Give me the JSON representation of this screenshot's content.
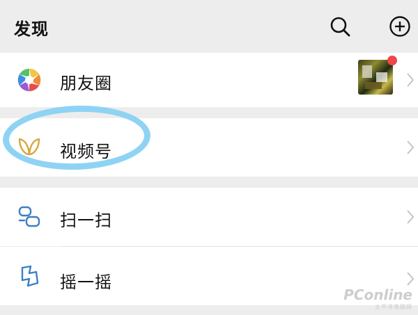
{
  "header": {
    "title": "发现",
    "search_icon": "search-icon",
    "add_icon": "plus-circle-icon"
  },
  "menu": {
    "moments": {
      "label": "朋友圈",
      "icon": "moments-aperture-icon"
    },
    "channels": {
      "label": "视频号",
      "icon": "channels-butterfly-icon"
    },
    "scan": {
      "label": "扫一扫",
      "icon": "scan-icon"
    },
    "shake": {
      "label": "摇一摇",
      "icon": "shake-icon"
    }
  },
  "colors": {
    "background": "#ededed",
    "row": "#ffffff",
    "highlight": "#8fd3f4",
    "badge": "#f0454a",
    "channels_gold": "#d9a63c",
    "icon_blue": "#3b7fc4"
  },
  "watermark": {
    "main": "PConline",
    "sub": "太平洋电脑网"
  }
}
